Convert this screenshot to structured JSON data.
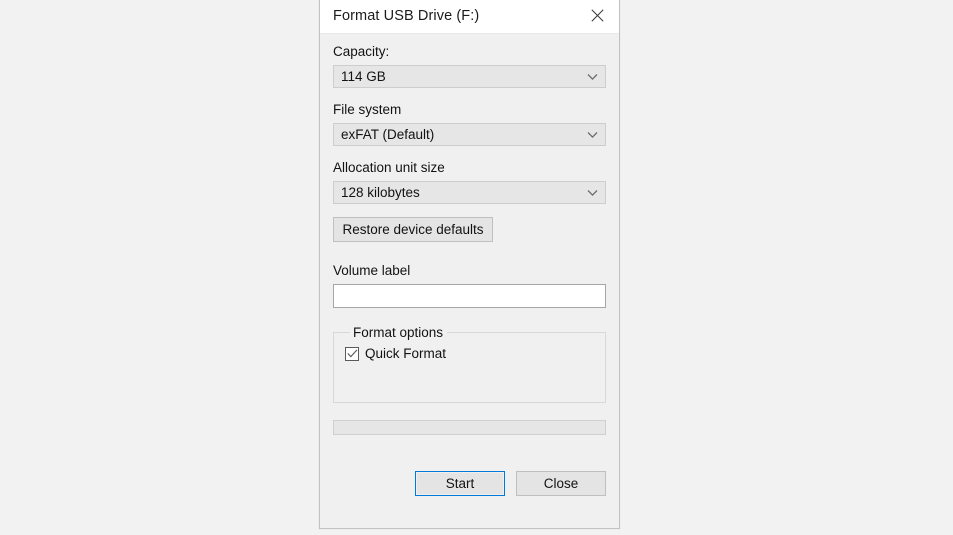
{
  "window": {
    "title": "Format USB Drive (F:)",
    "close_icon": "close-icon"
  },
  "form": {
    "capacity": {
      "label": "Capacity:",
      "value": "114 GB",
      "chevron_icon": "chevron-down-icon"
    },
    "file_system": {
      "label": "File system",
      "value": "exFAT (Default)",
      "chevron_icon": "chevron-down-icon"
    },
    "allocation_unit_size": {
      "label": "Allocation unit size",
      "value": "128 kilobytes",
      "chevron_icon": "chevron-down-icon"
    },
    "restore_defaults_label": "Restore device defaults",
    "volume_label": {
      "label": "Volume label",
      "value": "",
      "placeholder": ""
    },
    "format_options": {
      "legend": "Format options",
      "quick_format": {
        "label": "Quick Format",
        "checked": true,
        "check_icon": "checkmark-icon"
      }
    },
    "progress": {
      "value": 0
    }
  },
  "footer": {
    "start_label": "Start",
    "close_label": "Close"
  },
  "colors": {
    "accent": "#0078d7",
    "dialog_background": "#f0f0f0",
    "page_background": "#f2f2f2",
    "titlebar_background": "#ffffff",
    "text": "#121212",
    "control_background": "#e6e6e6",
    "control_border": "#cdcdcd"
  }
}
